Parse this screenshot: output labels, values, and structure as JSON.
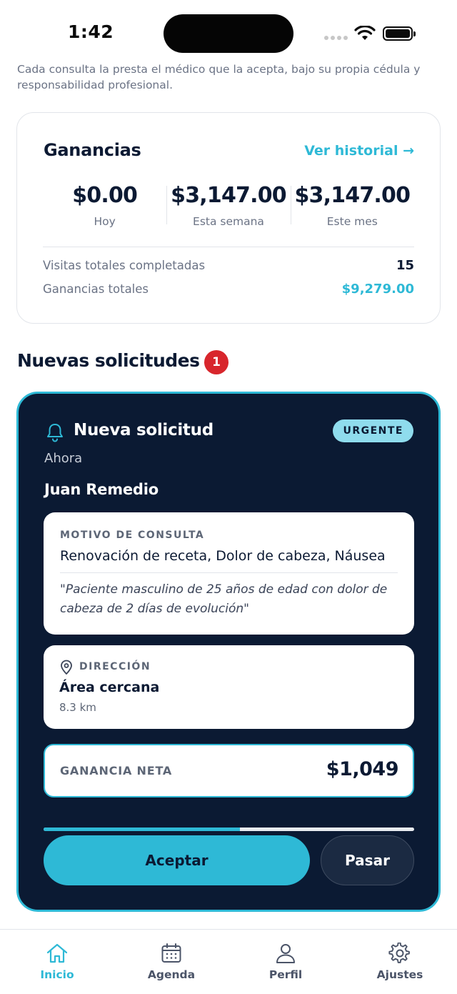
{
  "status_bar": {
    "time": "1:42"
  },
  "disclaimer": "Cada consulta la presta el médico que la acepta, bajo su propia cédula y responsabilidad profesional.",
  "earnings": {
    "title": "Ganancias",
    "history_link": "Ver historial →",
    "stats": [
      {
        "value": "$0.00",
        "label": "Hoy"
      },
      {
        "value": "$3,147.00",
        "label": "Esta semana"
      },
      {
        "value": "$3,147.00",
        "label": "Este mes"
      }
    ],
    "total_visits_label": "Visitas totales completadas",
    "total_visits_value": "15",
    "total_earnings_label": "Ganancias totales",
    "total_earnings_value": "$9,279.00"
  },
  "requests_section": {
    "title": "Nuevas solicitudes",
    "count": "1"
  },
  "request": {
    "title": "Nueva solicitud",
    "badge": "URGENTE",
    "time": "Ahora",
    "patient": "Juan Remedio",
    "reason_label": "MOTIVO DE CONSULTA",
    "reason": "Renovación de receta, Dolor de cabeza, Náusea",
    "note": "\"Paciente masculino de 25 años de edad con dolor de cabeza de 2 días de evolución\"",
    "address_label": "DIRECCIÓN",
    "address": "Área cercana",
    "distance": "8.3 km",
    "net_label": "GANANCIA NETA",
    "net_value": "$1,049",
    "countdown_progress": 0.53,
    "accept_label": "Aceptar",
    "pass_label": "Pasar"
  },
  "tab_bar": {
    "tabs": [
      {
        "label": "Inicio",
        "icon": "home-icon",
        "active": true
      },
      {
        "label": "Agenda",
        "icon": "calendar-icon",
        "active": false
      },
      {
        "label": "Perfil",
        "icon": "user-icon",
        "active": false
      },
      {
        "label": "Ajustes",
        "icon": "gear-icon",
        "active": false
      }
    ]
  },
  "colors": {
    "accent": "#2eb9d6",
    "navy": "#0b1a33",
    "urgent_badge": "#8fdced",
    "count_badge": "#d8262c"
  }
}
